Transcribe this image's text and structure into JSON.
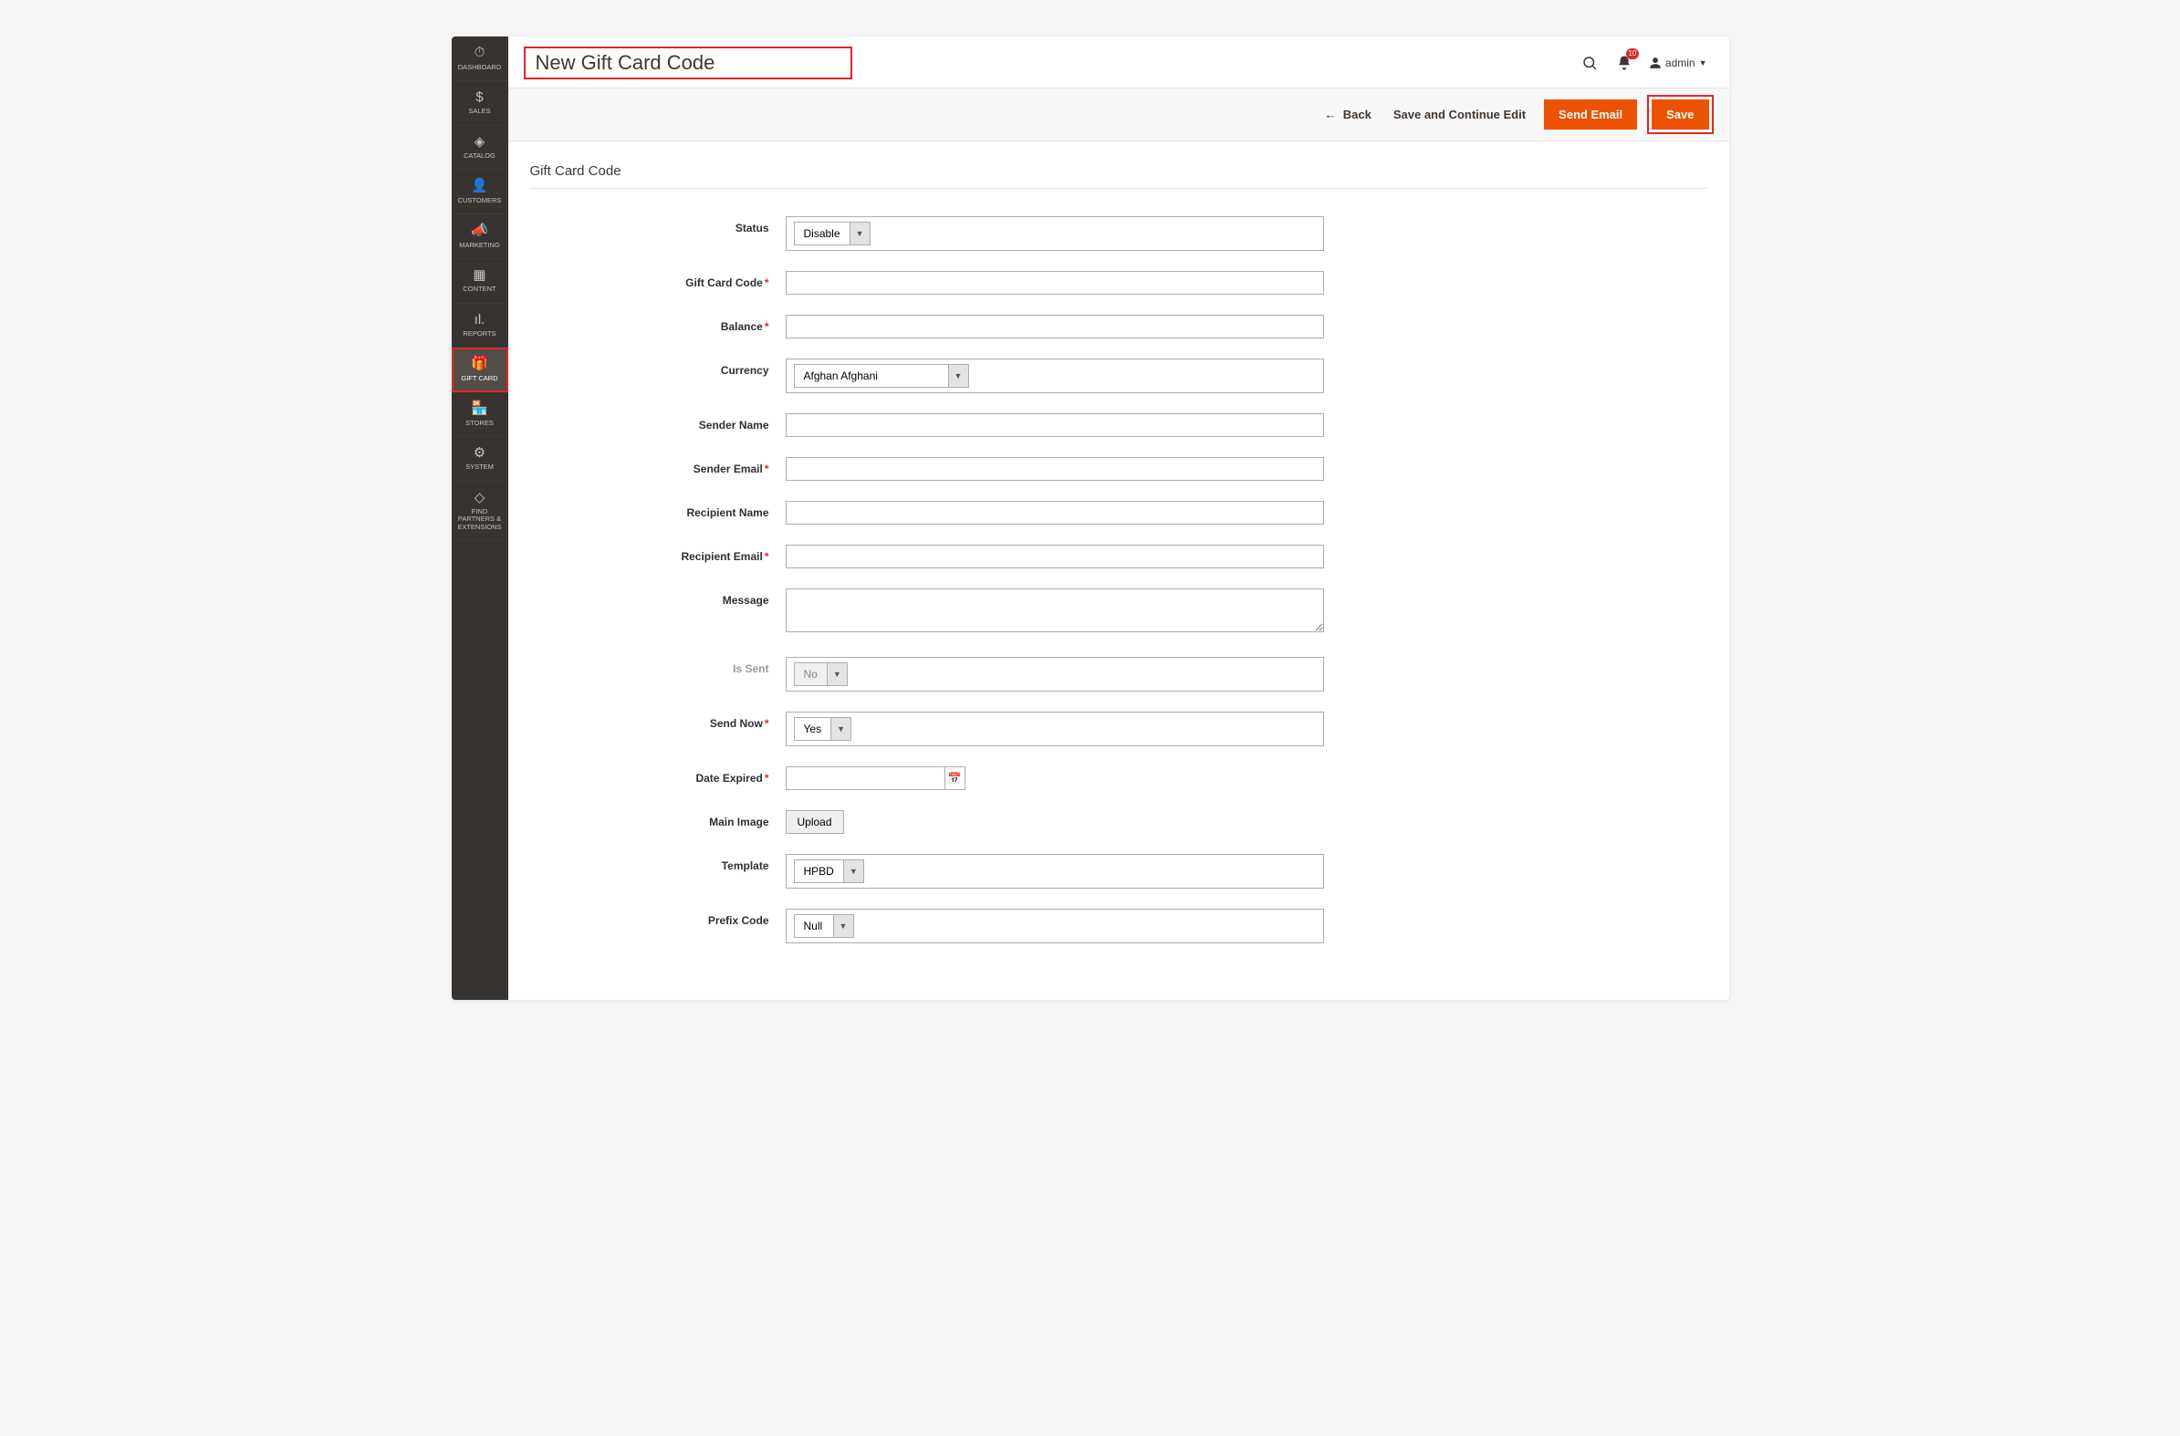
{
  "header": {
    "page_title": "New Gift Card Code",
    "notification_count": "10",
    "user_name": "admin"
  },
  "sidebar": {
    "items": [
      {
        "label": "DASHBOARD",
        "icon": "⌂"
      },
      {
        "label": "SALES",
        "icon": "$"
      },
      {
        "label": "CATALOG",
        "icon": "◆"
      },
      {
        "label": "CUSTOMERS",
        "icon": "👤"
      },
      {
        "label": "MARKETING",
        "icon": "📣"
      },
      {
        "label": "CONTENT",
        "icon": "▦"
      },
      {
        "label": "REPORTS",
        "icon": "ıl."
      },
      {
        "label": "GIFT CARD",
        "icon": "🎁"
      },
      {
        "label": "STORES",
        "icon": "🏪"
      },
      {
        "label": "SYSTEM",
        "icon": "⚙"
      },
      {
        "label": "FIND PARTNERS & EXTENSIONS",
        "icon": "◇"
      }
    ]
  },
  "actions": {
    "back": "Back",
    "save_continue": "Save and Continue Edit",
    "send_email": "Send Email",
    "save": "Save"
  },
  "form": {
    "section_title": "Gift Card Code",
    "labels": {
      "status": "Status",
      "gift_card_code": "Gift Card Code",
      "balance": "Balance",
      "currency": "Currency",
      "sender_name": "Sender Name",
      "sender_email": "Sender Email",
      "recipient_name": "Recipient Name",
      "recipient_email": "Recipient Email",
      "message": "Message",
      "is_sent": "Is Sent",
      "send_now": "Send Now",
      "date_expired": "Date Expired",
      "main_image": "Main Image",
      "template": "Template",
      "prefix_code": "Prefix Code"
    },
    "values": {
      "status": "Disable",
      "gift_card_code": "",
      "balance": "",
      "currency": "Afghan Afghani",
      "sender_name": "",
      "sender_email": "",
      "recipient_name": "",
      "recipient_email": "",
      "message": "",
      "is_sent": "No",
      "send_now": "Yes",
      "date_expired": "",
      "main_image_btn": "Upload",
      "template": "HPBD",
      "prefix_code": "Null"
    }
  }
}
